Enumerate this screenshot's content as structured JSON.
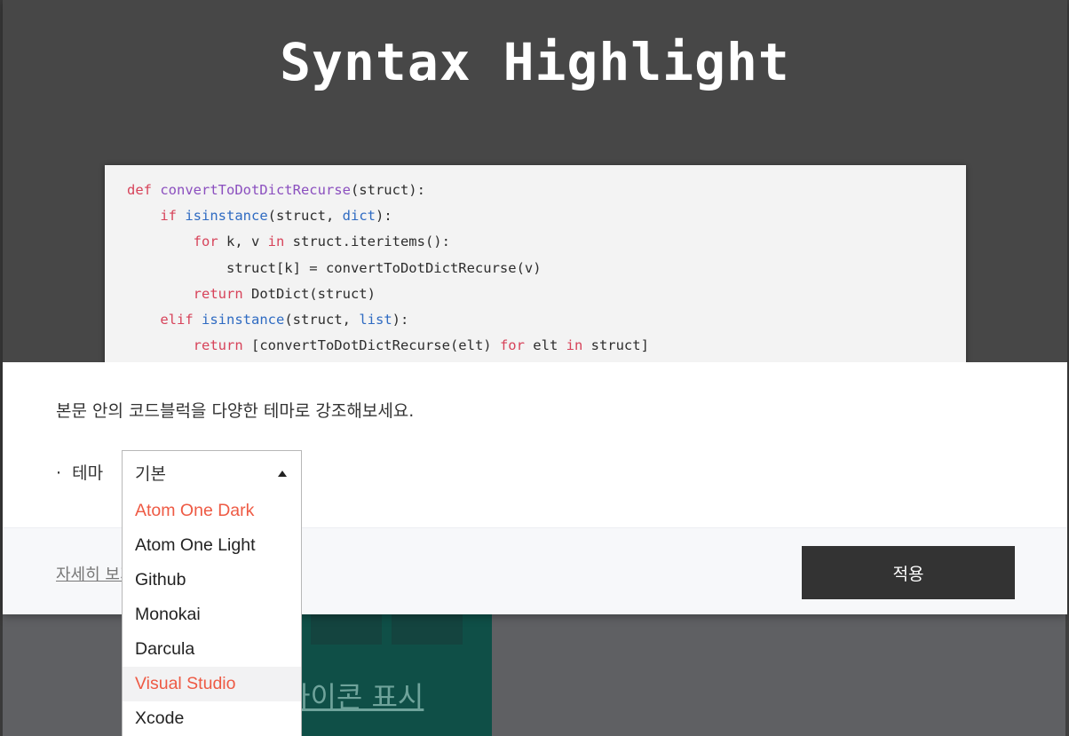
{
  "modal": {
    "title": "Syntax Highlight",
    "description": "본문 안의 코드블럭을 다양한 테마로 강조해보세요.",
    "theme_label": "테마",
    "more_link": "자세히 보기",
    "apply_label": "적용"
  },
  "code_lines": [
    [
      {
        "t": "def ",
        "c": "kw"
      },
      {
        "t": "convertToDotDictRecurse",
        "c": "fn"
      },
      {
        "t": "(struct):",
        "c": ""
      }
    ],
    [
      {
        "t": "    ",
        "c": ""
      },
      {
        "t": "if ",
        "c": "kw"
      },
      {
        "t": "isinstance",
        "c": "bi"
      },
      {
        "t": "(struct, ",
        "c": ""
      },
      {
        "t": "dict",
        "c": "bi"
      },
      {
        "t": "):",
        "c": ""
      }
    ],
    [
      {
        "t": "        ",
        "c": ""
      },
      {
        "t": "for ",
        "c": "kw"
      },
      {
        "t": "k, v ",
        "c": ""
      },
      {
        "t": "in ",
        "c": "kw"
      },
      {
        "t": "struct.iteritems():",
        "c": ""
      }
    ],
    [
      {
        "t": "            struct[k] = convertToDotDictRecurse(v)",
        "c": ""
      }
    ],
    [
      {
        "t": "        ",
        "c": ""
      },
      {
        "t": "return ",
        "c": "kw"
      },
      {
        "t": "DotDict(struct)",
        "c": ""
      }
    ],
    [
      {
        "t": "    ",
        "c": ""
      },
      {
        "t": "elif ",
        "c": "kw"
      },
      {
        "t": "isinstance",
        "c": "bi"
      },
      {
        "t": "(struct, ",
        "c": ""
      },
      {
        "t": "list",
        "c": "bi"
      },
      {
        "t": "):",
        "c": ""
      }
    ],
    [
      {
        "t": "        ",
        "c": ""
      },
      {
        "t": "return ",
        "c": "kw"
      },
      {
        "t": "[convertToDotDictRecurse(elt) ",
        "c": ""
      },
      {
        "t": "for ",
        "c": "kw"
      },
      {
        "t": "elt ",
        "c": ""
      },
      {
        "t": "in ",
        "c": "kw"
      },
      {
        "t": "struct]",
        "c": ""
      }
    ]
  ],
  "theme_select": {
    "selected": "기본",
    "options": [
      "Atom One Dark",
      "Atom One Light",
      "Github",
      "Monokai",
      "Darcula",
      "Visual Studio",
      "Xcode"
    ],
    "accent_options": [
      0,
      5
    ],
    "hovered_option": 5
  },
  "background": {
    "card_text": "아이콘 표시"
  },
  "colors": {
    "accent": "#ee5a44",
    "keyword": "#d7435a",
    "function": "#8b4fbf",
    "builtin": "#2f6bc2",
    "apply_button": "#333333"
  }
}
